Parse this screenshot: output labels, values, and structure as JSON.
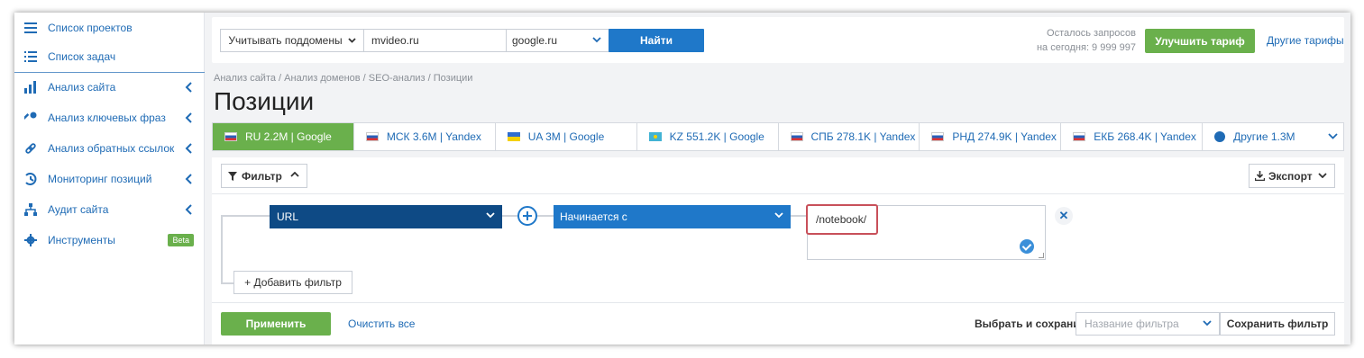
{
  "sidebar": {
    "items": [
      {
        "label": "Список проектов",
        "icon": "menu-icon",
        "has_chevron": false
      },
      {
        "label": "Список задач",
        "icon": "list-icon",
        "has_chevron": false
      },
      {
        "label": "Анализ сайта",
        "icon": "chart-icon",
        "has_chevron": true
      },
      {
        "label": "Анализ ключевых фраз",
        "icon": "key-icon",
        "has_chevron": true
      },
      {
        "label": "Анализ обратных ссылок",
        "icon": "link-icon",
        "has_chevron": true
      },
      {
        "label": "Мониторинг позиций",
        "icon": "monitor-icon",
        "has_chevron": true
      },
      {
        "label": "Аудит сайта",
        "icon": "sitemap-icon",
        "has_chevron": true
      },
      {
        "label": "Инструменты",
        "icon": "gear-icon",
        "has_chevron": false,
        "badge": "Beta"
      }
    ]
  },
  "search": {
    "subdomains_label": "Учитывать поддомены",
    "domain_value": "mvideo.ru",
    "engine_value": "google.ru",
    "find_label": "Найти"
  },
  "quota": {
    "line1": "Осталось запросов",
    "line2": "на сегодня: 9 999 997"
  },
  "upgrade_label": "Улучшить тариф",
  "other_tariffs_label": "Другие тарифы",
  "breadcrumb": "Анализ сайта / Анализ доменов / SEO-анализ / Позиции",
  "page_title": "Позиции",
  "region_tabs": [
    {
      "label": "RU 2.2M | Google",
      "flag": "ru",
      "active": true
    },
    {
      "label": "МСК 3.6M | Yandex",
      "flag": "ru",
      "active": false
    },
    {
      "label": "UA 3M | Google",
      "flag": "ua",
      "active": false
    },
    {
      "label": "KZ 551.2K | Google",
      "flag": "kz",
      "active": false
    },
    {
      "label": "СПБ 278.1K | Yandex",
      "flag": "ru",
      "active": false
    },
    {
      "label": "РНД 274.9K | Yandex",
      "flag": "ru",
      "active": false
    },
    {
      "label": "ЕКБ 268.4K | Yandex",
      "flag": "ru",
      "active": false
    },
    {
      "label": "Другие 1.3M",
      "flag": "globe",
      "active": false
    }
  ],
  "filter": {
    "toggle_label": "Фильтр",
    "export_label": "Экспорт",
    "field_value": "URL",
    "operator_value": "Начинается с",
    "text_value": "/notebook/",
    "add_filter_label": "+ Добавить фильтр",
    "apply_label": "Применить",
    "clear_label": "Очистить все",
    "choose_save_label": "Выбрать и сохранить",
    "filter_name_placeholder": "Название фильтра",
    "save_filter_label": "Сохранить фильтр"
  },
  "colors": {
    "accent_blue": "#1f78c9",
    "dark_blue": "#0e4a85",
    "green": "#6ab04c",
    "link": "#1f6bb5",
    "highlight_red": "#c8505a"
  }
}
